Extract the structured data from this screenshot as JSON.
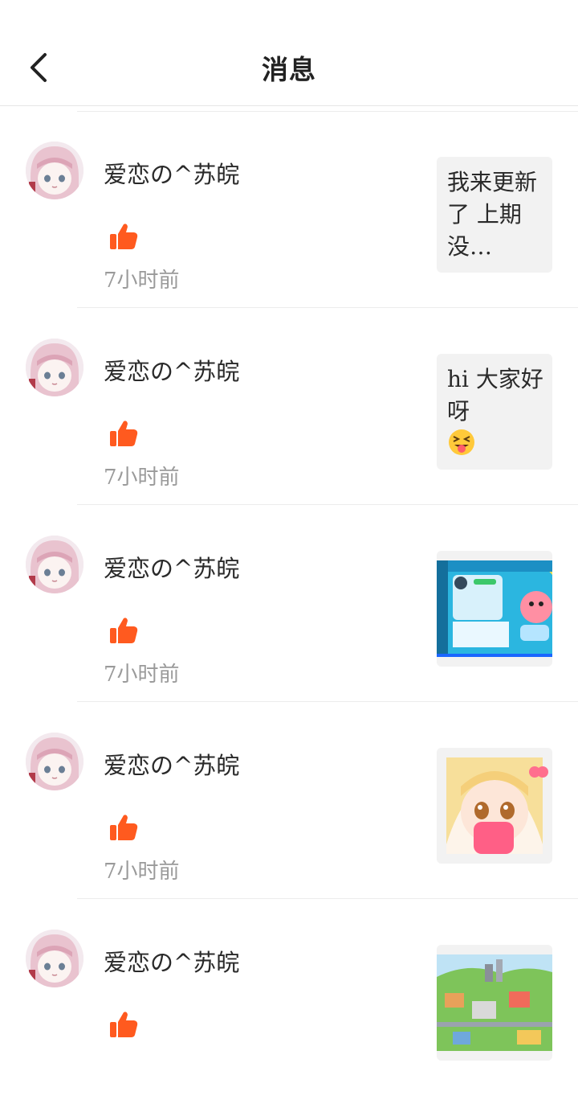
{
  "header": {
    "title": "消息",
    "back_icon": "chevron-left-icon"
  },
  "colors": {
    "accent": "#ff5a1f",
    "text": "#2a2a2a",
    "muted": "#9a9a9a"
  },
  "messages": [
    {
      "username": "爱恋の^苏皖",
      "action_icon": "thumbs-up-icon",
      "time": "7小时前",
      "preview_type": "text",
      "preview_text": "我来更新了 上期没…"
    },
    {
      "username": "爱恋の^苏皖",
      "action_icon": "thumbs-up-icon",
      "time": "7小时前",
      "preview_type": "text",
      "preview_text_a": "hi 大家好",
      "preview_text_b": "呀",
      "preview_emoji": "squinting-tongue-emoji",
      "preview_text_c": "…"
    },
    {
      "username": "爱恋の^苏皖",
      "action_icon": "thumbs-up-icon",
      "time": "7小时前",
      "preview_type": "image",
      "preview_image": "game-profile-screenshot-thumbnail"
    },
    {
      "username": "爱恋の^苏皖",
      "action_icon": "thumbs-up-icon",
      "time": "7小时前",
      "preview_type": "image",
      "preview_image": "anime-girl-with-pink-phone-thumbnail"
    },
    {
      "username": "爱恋の^苏皖",
      "action_icon": "thumbs-up-icon",
      "time": "",
      "preview_type": "image",
      "preview_image": "cartoon-town-map-thumbnail"
    }
  ]
}
